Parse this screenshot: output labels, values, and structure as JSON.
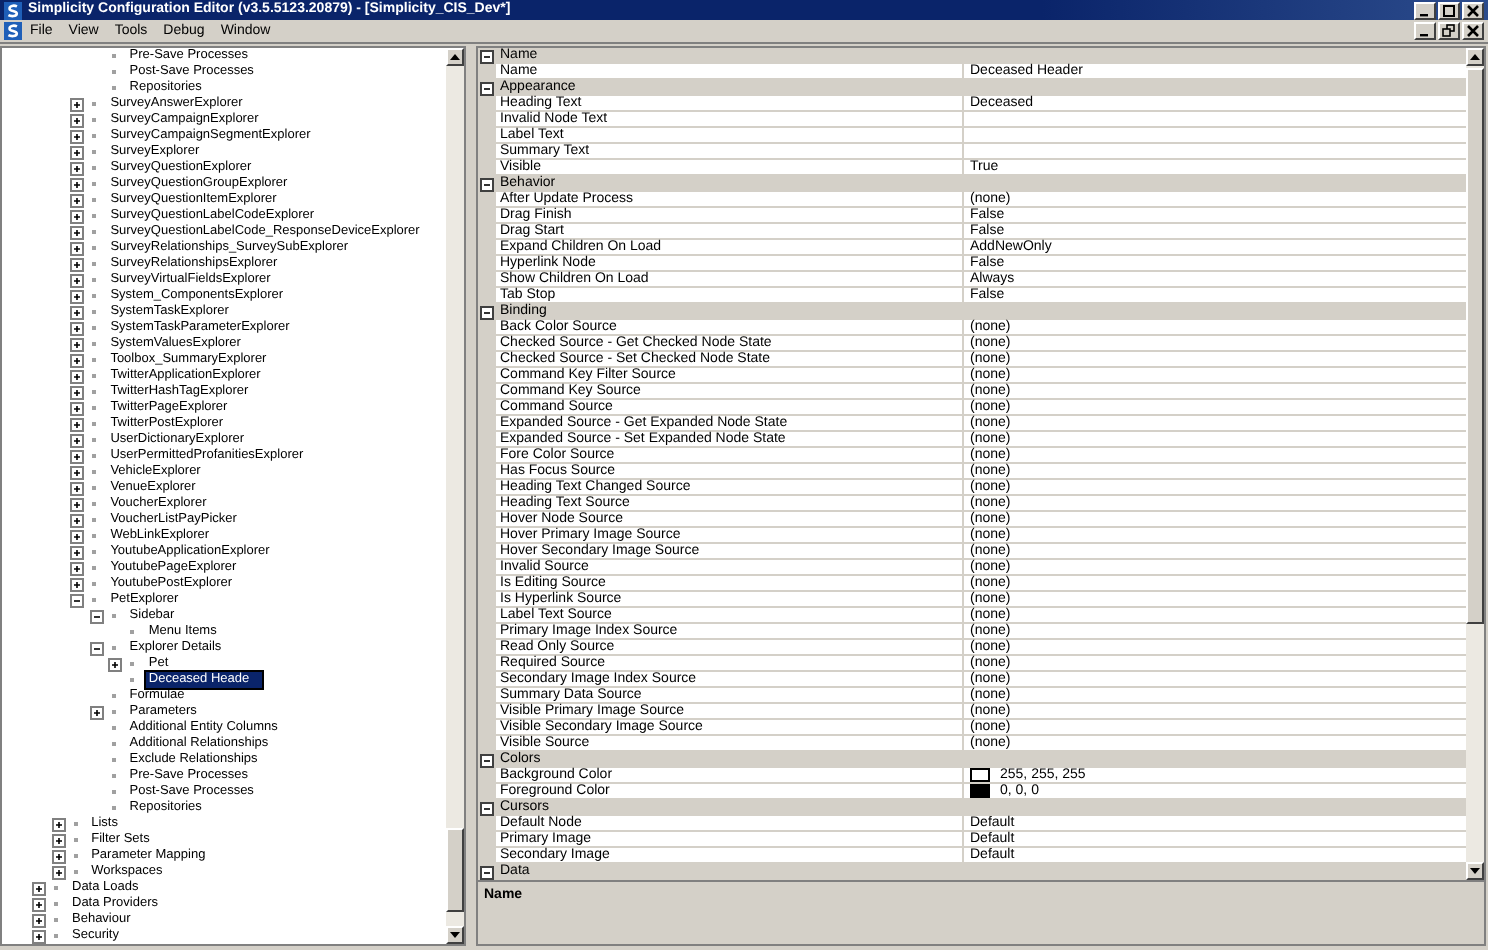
{
  "window": {
    "title": "Simplicity Configuration Editor (v3.5.5123.20879) - [Simplicity_CIS_Dev*]"
  },
  "menu": [
    "File",
    "View",
    "Tools",
    "Debug",
    "Window"
  ],
  "tree": {
    "items": [
      {
        "children": [
          {
            "children": [
              {
                "children": [
                  {
                    "label": "Pre-Save Processes",
                    "selected": false
                  },
                  {
                    "label": "Post-Save Processes",
                    "selected": false
                  },
                  {
                    "label": "Repositories",
                    "selected": false
                  }
                ]
              },
              {
                "label": "SurveyAnswerExplorer",
                "expanded": false,
                "selected": false
              },
              {
                "label": "SurveyCampaignExplorer",
                "expanded": false,
                "selected": false
              },
              {
                "label": "SurveyCampaignSegmentExplorer",
                "expanded": false,
                "selected": false
              },
              {
                "label": "SurveyExplorer",
                "expanded": false,
                "selected": false
              },
              {
                "label": "SurveyQuestionExplorer",
                "expanded": false,
                "selected": false
              },
              {
                "label": "SurveyQuestionGroupExplorer",
                "expanded": false,
                "selected": false
              },
              {
                "label": "SurveyQuestionItemExplorer",
                "expanded": false,
                "selected": false
              },
              {
                "label": "SurveyQuestionLabelCodeExplorer",
                "expanded": false,
                "selected": false
              },
              {
                "label": "SurveyQuestionLabelCode_ResponseDeviceExplorer",
                "expanded": false,
                "selected": false
              },
              {
                "label": "SurveyRelationships_SurveySubExplorer",
                "expanded": false,
                "selected": false
              },
              {
                "label": "SurveyRelationshipsExplorer",
                "expanded": false,
                "selected": false
              },
              {
                "label": "SurveyVirtualFieldsExplorer",
                "expanded": false,
                "selected": false
              },
              {
                "label": "System_ComponentsExplorer",
                "expanded": false,
                "selected": false
              },
              {
                "label": "SystemTaskExplorer",
                "expanded": false,
                "selected": false
              },
              {
                "label": "SystemTaskParameterExplorer",
                "expanded": false,
                "selected": false
              },
              {
                "label": "SystemValuesExplorer",
                "expanded": false,
                "selected": false
              },
              {
                "label": "Toolbox_SummaryExplorer",
                "expanded": false,
                "selected": false
              },
              {
                "label": "TwitterApplicationExplorer",
                "expanded": false,
                "selected": false
              },
              {
                "label": "TwitterHashTagExplorer",
                "expanded": false,
                "selected": false
              },
              {
                "label": "TwitterPageExplorer",
                "expanded": false,
                "selected": false
              },
              {
                "label": "TwitterPostExplorer",
                "expanded": false,
                "selected": false
              },
              {
                "label": "UserDictionaryExplorer",
                "expanded": false,
                "selected": false
              },
              {
                "label": "UserPermittedProfanitiesExplorer",
                "expanded": false,
                "selected": false
              },
              {
                "label": "VehicleExplorer",
                "expanded": false,
                "selected": false
              },
              {
                "label": "VenueExplorer",
                "expanded": false,
                "selected": false
              },
              {
                "label": "VoucherExplorer",
                "expanded": false,
                "selected": false
              },
              {
                "label": "VoucherListPayPicker",
                "expanded": false,
                "selected": false
              },
              {
                "label": "WebLinkExplorer",
                "expanded": false,
                "selected": false
              },
              {
                "label": "YoutubeApplicationExplorer",
                "expanded": false,
                "selected": false
              },
              {
                "label": "YoutubePageExplorer",
                "expanded": false,
                "selected": false
              },
              {
                "label": "YoutubePostExplorer",
                "expanded": false,
                "selected": false
              },
              {
                "label": "PetExplorer",
                "expanded": true,
                "selected": false,
                "children": [
                  {
                    "label": "Sidebar",
                    "expanded": true,
                    "selected": false,
                    "children": [
                      {
                        "label": "Menu Items",
                        "selected": false
                      }
                    ]
                  },
                  {
                    "label": "Explorer Details",
                    "expanded": true,
                    "selected": false,
                    "children": [
                      {
                        "label": "Pet",
                        "expanded": false,
                        "selected": false
                      },
                      {
                        "label": "Deceased Heade",
                        "selected": true
                      }
                    ]
                  },
                  {
                    "label": "Formulae",
                    "selected": false
                  },
                  {
                    "label": "Parameters",
                    "expanded": false,
                    "selected": false
                  },
                  {
                    "label": "Additional Entity Columns",
                    "selected": false
                  },
                  {
                    "label": "Additional Relationships",
                    "selected": false
                  },
                  {
                    "label": "Exclude Relationships",
                    "selected": false
                  },
                  {
                    "label": "Pre-Save Processes",
                    "selected": false
                  },
                  {
                    "label": "Post-Save Processes",
                    "selected": false
                  },
                  {
                    "label": "Repositories",
                    "selected": false
                  }
                ]
              }
            ]
          },
          {
            "label": "Lists",
            "expanded": false,
            "selected": false
          },
          {
            "label": "Filter Sets",
            "expanded": false,
            "selected": false
          },
          {
            "label": "Parameter Mapping",
            "expanded": false,
            "selected": false
          },
          {
            "label": "Workspaces",
            "expanded": false,
            "selected": false
          }
        ]
      },
      {
        "label": "Data Loads",
        "expanded": false,
        "selected": false
      },
      {
        "label": "Data Providers",
        "expanded": false,
        "selected": false
      },
      {
        "label": "Behaviour",
        "expanded": false,
        "selected": false
      },
      {
        "label": "Security",
        "expanded": false,
        "selected": false
      }
    ]
  },
  "property_grid": {
    "categories": [
      {
        "name": "Name",
        "expanded": true,
        "properties": [
          {
            "name": "Name",
            "value": "Deceased Header"
          }
        ]
      },
      {
        "name": "Appearance",
        "expanded": true,
        "properties": [
          {
            "name": "Heading Text",
            "value": "Deceased"
          },
          {
            "name": "Invalid Node Text"
          },
          {
            "name": "Label Text"
          },
          {
            "name": "Summary Text"
          },
          {
            "name": "Visible",
            "value": "True"
          }
        ]
      },
      {
        "name": "Behavior",
        "expanded": true,
        "properties": [
          {
            "name": "After Update Process",
            "value": "(none)"
          },
          {
            "name": "Drag Finish",
            "value": "False"
          },
          {
            "name": "Drag Start",
            "value": "False"
          },
          {
            "name": "Expand Children On Load",
            "value": "AddNewOnly"
          },
          {
            "name": "Hyperlink Node",
            "value": "False"
          },
          {
            "name": "Show Children On Load",
            "value": "Always"
          },
          {
            "name": "Tab Stop",
            "value": "False"
          }
        ]
      },
      {
        "name": "Binding",
        "expanded": true,
        "properties": [
          {
            "name": "Back Color Source",
            "value": "(none)"
          },
          {
            "name": "Checked Source - Get Checked Node State",
            "value": "(none)"
          },
          {
            "name": "Checked Source - Set Checked Node State",
            "value": "(none)"
          },
          {
            "name": "Command Key Filter Source",
            "value": "(none)"
          },
          {
            "name": "Command Key Source",
            "value": "(none)"
          },
          {
            "name": "Command Source",
            "value": "(none)"
          },
          {
            "name": "Expanded Source - Get Expanded Node State",
            "value": "(none)"
          },
          {
            "name": "Expanded Source - Set Expanded Node State",
            "value": "(none)"
          },
          {
            "name": "Fore Color Source",
            "value": "(none)"
          },
          {
            "name": "Has Focus Source",
            "value": "(none)"
          },
          {
            "name": "Heading Text Changed Source",
            "value": "(none)"
          },
          {
            "name": "Heading Text Source",
            "value": "(none)"
          },
          {
            "name": "Hover Node Source",
            "value": "(none)"
          },
          {
            "name": "Hover Primary Image Source",
            "value": "(none)"
          },
          {
            "name": "Hover Secondary Image Source",
            "value": "(none)"
          },
          {
            "name": "Invalid Source",
            "value": "(none)"
          },
          {
            "name": "Is Editing Source",
            "value": "(none)"
          },
          {
            "name": "Is Hyperlink Source",
            "value": "(none)"
          },
          {
            "name": "Label Text Source",
            "value": "(none)"
          },
          {
            "name": "Primary Image Index Source",
            "value": "(none)"
          },
          {
            "name": "Read Only Source",
            "value": "(none)"
          },
          {
            "name": "Required Source",
            "value": "(none)"
          },
          {
            "name": "Secondary Image Index Source",
            "value": "(none)"
          },
          {
            "name": "Summary Data Source",
            "value": "(none)"
          },
          {
            "name": "Visible Primary Image Source",
            "value": "(none)"
          },
          {
            "name": "Visible Secondary Image Source",
            "value": "(none)"
          },
          {
            "name": "Visible Source",
            "value": "(none)"
          }
        ]
      },
      {
        "name": "Colors",
        "expanded": true,
        "properties": [
          {
            "name": "Background Color",
            "value": "255, 255, 255",
            "color": "#ffffff"
          },
          {
            "name": "Foreground Color",
            "value": "0, 0, 0",
            "color": "#000000"
          }
        ]
      },
      {
        "name": "Cursors",
        "expanded": true,
        "properties": [
          {
            "name": "Default Node",
            "value": "Default"
          },
          {
            "name": "Primary Image",
            "value": "Default"
          },
          {
            "name": "Secondary Image",
            "value": "Default"
          }
        ]
      },
      {
        "name": "Data",
        "expanded": true
      }
    ],
    "description": {
      "title": "Name"
    }
  }
}
